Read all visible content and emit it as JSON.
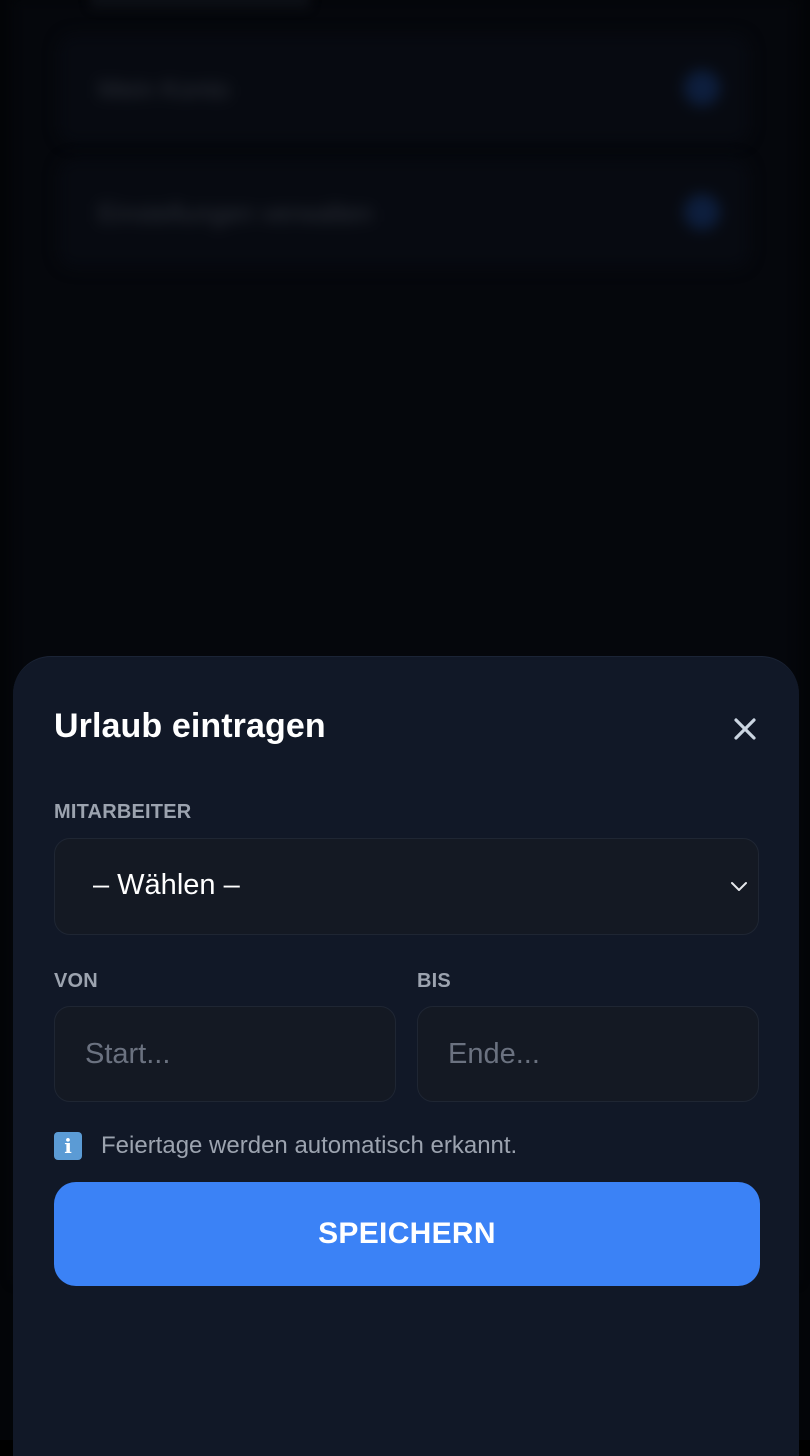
{
  "background_page": {
    "rows": [
      {
        "label": "Mein Konto"
      },
      {
        "label": "Einstellungen verwalten"
      }
    ]
  },
  "dialog": {
    "title": "Urlaub eintragen",
    "close_icon": "close-icon",
    "employee": {
      "label": "MITARBEITER",
      "selected_value": "– Wählen –",
      "chevron_icon": "chevron-down-icon"
    },
    "from": {
      "label": "VON",
      "placeholder": "Start..."
    },
    "to": {
      "label": "BIS",
      "placeholder": "Ende..."
    },
    "info": {
      "icon": "info-icon",
      "icon_glyph": "i",
      "text": "Feiertage werden automatisch erkannt."
    },
    "save_label": "SPEICHERN"
  },
  "colors": {
    "sheet_background": "#111827",
    "input_background": "#141923",
    "accent": "#3b82f6",
    "label": "#9ca3af",
    "info_icon": "#5b9bd5"
  }
}
